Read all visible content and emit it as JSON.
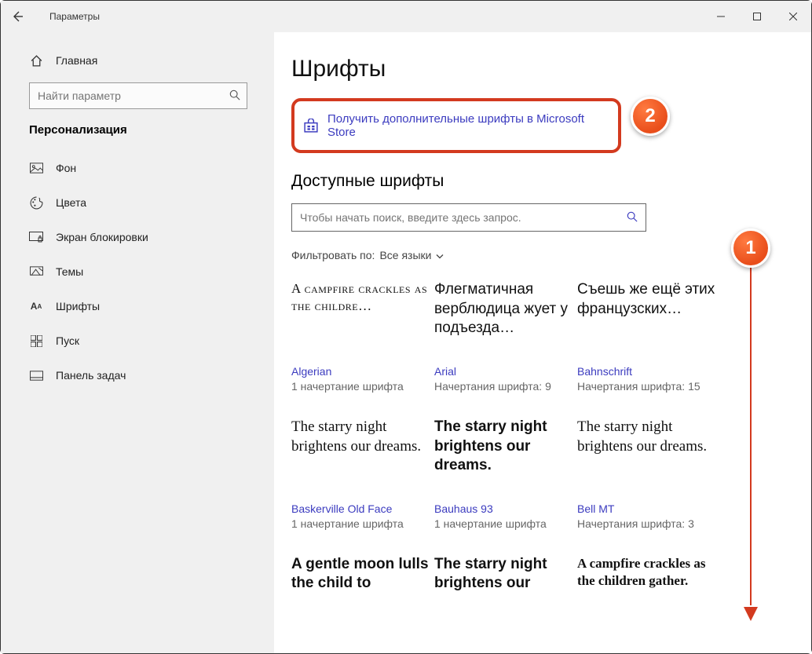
{
  "window": {
    "title": "Параметры"
  },
  "sidebar": {
    "home": "Главная",
    "search_placeholder": "Найти параметр",
    "section": "Персонализация",
    "items": [
      {
        "label": "Фон"
      },
      {
        "label": "Цвета"
      },
      {
        "label": "Экран блокировки"
      },
      {
        "label": "Темы"
      },
      {
        "label": "Шрифты"
      },
      {
        "label": "Пуск"
      },
      {
        "label": "Панель задач"
      }
    ]
  },
  "main": {
    "title": "Шрифты",
    "store_link": "Получить дополнительные шрифты в Microsoft Store",
    "available_head": "Доступные шрифты",
    "font_search_placeholder": "Чтобы начать поиск, введите здесь запрос.",
    "filter_label": "Фильтровать по:",
    "filter_value": "Все языки",
    "fonts": [
      {
        "preview": "A campfire crackles as the childre…",
        "name": "Algerian",
        "meta": "1 начертание шрифта",
        "cls": "p-algerian"
      },
      {
        "preview": "Флегматичная верблюдица жует у подъезда…",
        "name": "Arial",
        "meta": "Начертания шрифта: 9",
        "cls": "p-arial"
      },
      {
        "preview": "Съешь же ещё этих французских…",
        "name": "Bahnschrift",
        "meta": "Начертания шрифта: 15",
        "cls": "p-bahn"
      },
      {
        "preview": "The starry night brightens our dreams.",
        "name": "Baskerville Old Face",
        "meta": "1 начертание шрифта",
        "cls": "p-bask"
      },
      {
        "preview": "The starry night brightens our dreams.",
        "name": "Bauhaus 93",
        "meta": "1 начертание шрифта",
        "cls": "p-bauhaus"
      },
      {
        "preview": "The starry night brightens our dreams.",
        "name": "Bell MT",
        "meta": "Начертания шрифта: 3",
        "cls": "p-bell"
      },
      {
        "preview": "A gentle moon lulls the child to",
        "name": "",
        "meta": "",
        "cls": "p-row3a"
      },
      {
        "preview": "The starry night brightens our",
        "name": "",
        "meta": "",
        "cls": "p-row3b"
      },
      {
        "preview": "A campfire crackles as the children gather.",
        "name": "",
        "meta": "",
        "cls": "p-row3c"
      }
    ]
  },
  "callouts": {
    "one": "1",
    "two": "2"
  }
}
